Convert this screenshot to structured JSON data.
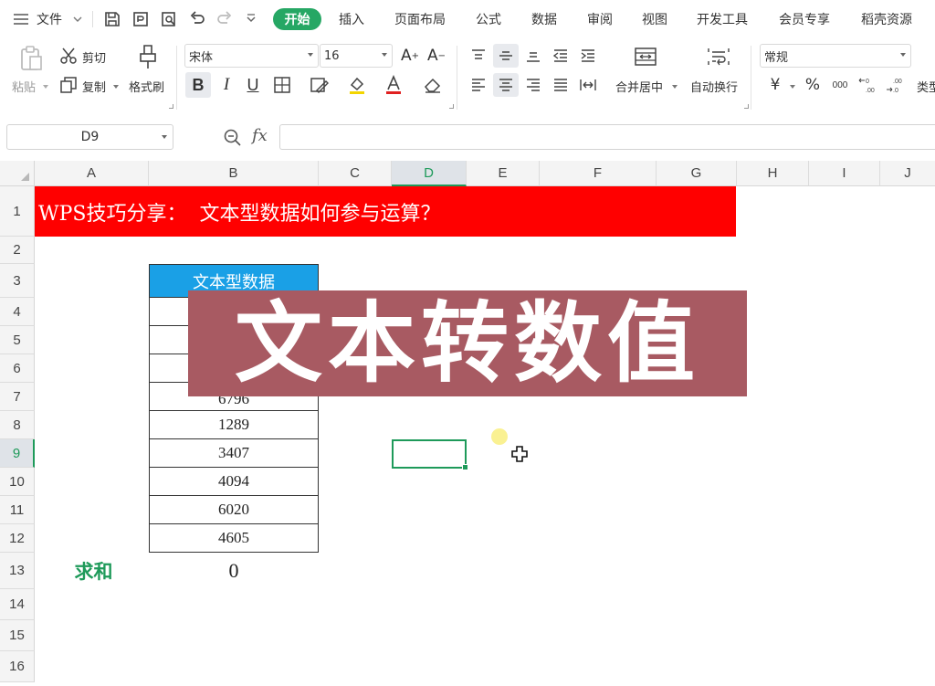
{
  "menubar": {
    "file_label": "文件",
    "tabs": [
      {
        "label": "开始",
        "active": true
      },
      {
        "label": "插入"
      },
      {
        "label": "页面布局"
      },
      {
        "label": "公式"
      },
      {
        "label": "数据"
      },
      {
        "label": "审阅"
      },
      {
        "label": "视图"
      },
      {
        "label": "开发工具"
      },
      {
        "label": "会员专享"
      },
      {
        "label": "稻壳资源"
      }
    ]
  },
  "ribbon": {
    "paste_label": "粘贴",
    "cut_label": "剪切",
    "copy_label": "复制",
    "format_painter_label": "格式刷",
    "font_name": "宋体",
    "font_size": "16",
    "merge_center_label": "合并居中",
    "wrap_text_label": "自动换行",
    "number_format": "常规",
    "type_label_partial": "类型",
    "currency_symbol": "¥",
    "percent_symbol": "%",
    "thousands_symbol": "000"
  },
  "formula_bar": {
    "name_box": "D9",
    "fx_label": "fx",
    "content": ""
  },
  "sheet": {
    "columns": [
      "A",
      "B",
      "C",
      "D",
      "E",
      "F",
      "G",
      "H",
      "I",
      "J"
    ],
    "rows": [
      "1",
      "2",
      "3",
      "4",
      "5",
      "6",
      "7",
      "8",
      "9",
      "10",
      "11",
      "12",
      "13",
      "14",
      "15",
      "16"
    ],
    "selected_column": "D",
    "selected_row": "9",
    "title_text": "WPS技巧分享：  文本型数据如何参与运算？",
    "table_header": "文本型数据",
    "table_values": [
      "",
      "",
      "",
      "6796",
      "1289",
      "3407",
      "4094",
      "6020",
      "4605"
    ],
    "sum_label": "求和",
    "sum_value": "0"
  },
  "overlay": {
    "banner_text": "文本转数值"
  },
  "colors": {
    "accent_green": "#26a764",
    "title_red": "#ff0000",
    "header_blue": "#1aa0e6",
    "banner_bg": "#a85a62"
  }
}
